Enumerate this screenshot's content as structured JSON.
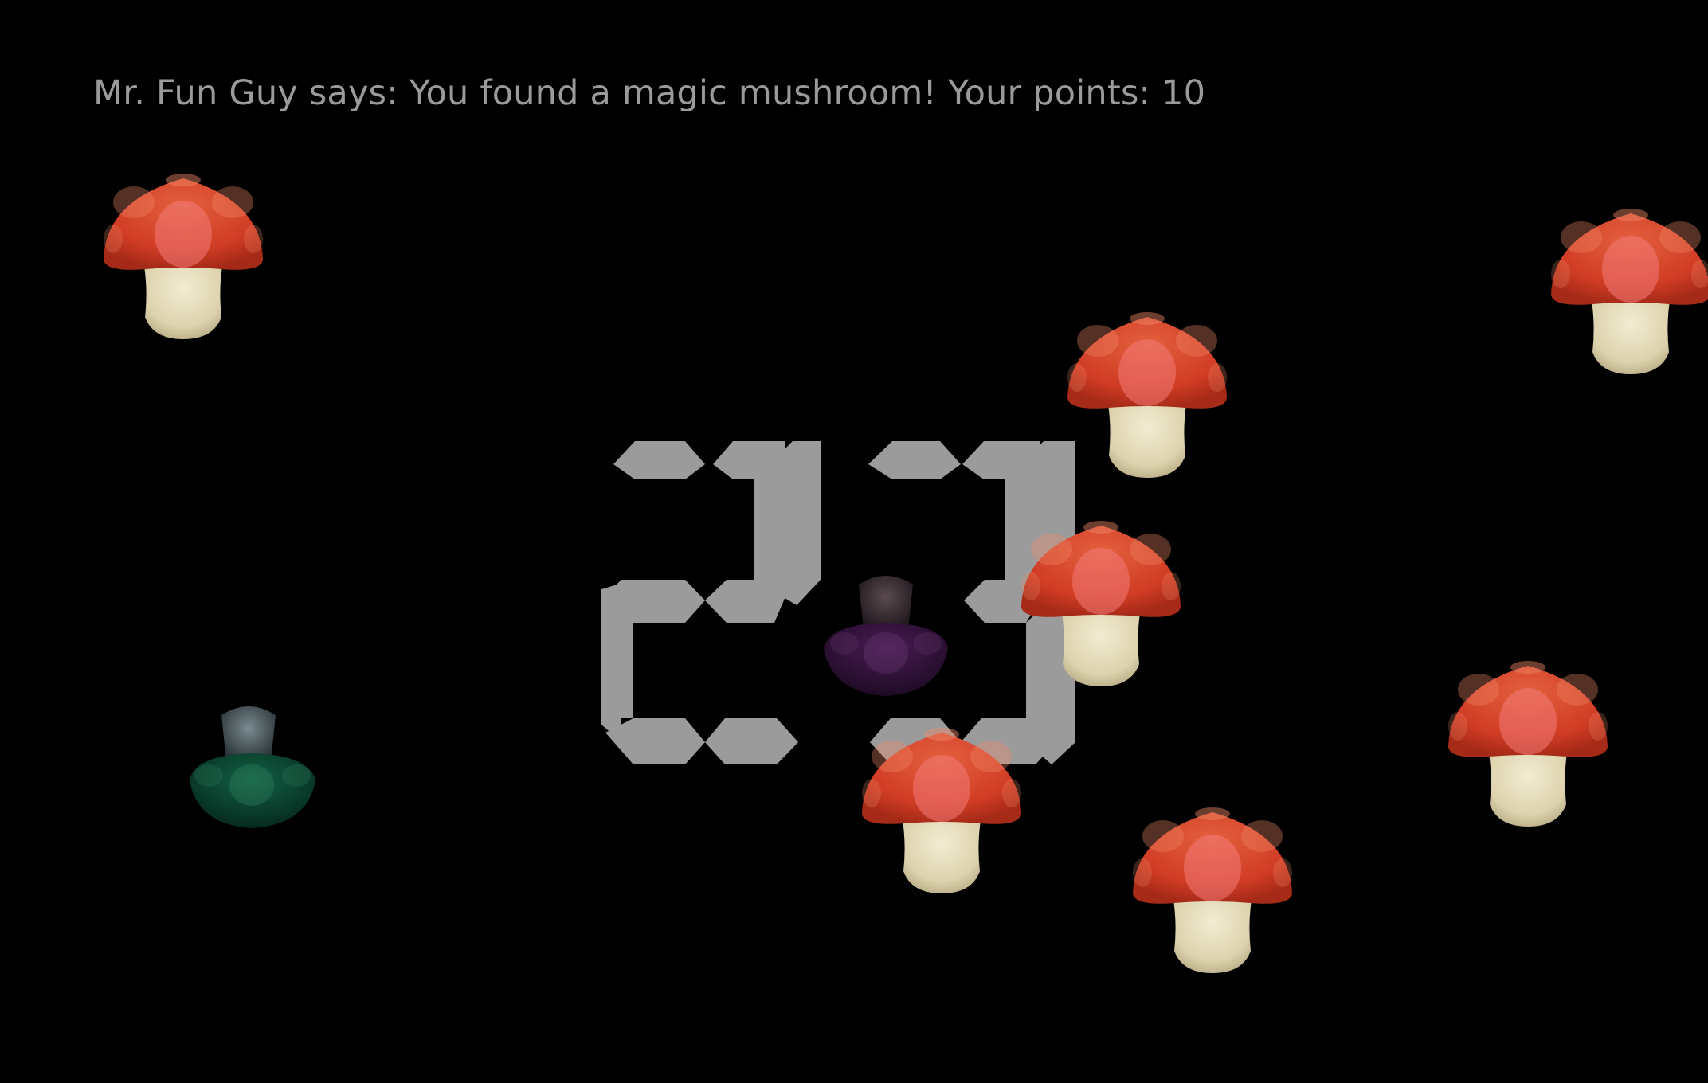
{
  "message": "Mr. Fun Guy says: You found a magic mushroom! Your points: 10",
  "timer": {
    "display": "23",
    "color": "#9b9b9b"
  },
  "colors": {
    "background": "#000000",
    "text": "#9a9a9a",
    "red_cap": "#d6452a",
    "stem": "#e9e2c2",
    "purple_cap": "#3a1642",
    "green_cap": "#0e4a33"
  },
  "mushrooms": [
    {
      "kind": "red",
      "icon": "red-mushroom-icon"
    },
    {
      "kind": "red",
      "icon": "red-mushroom-icon"
    },
    {
      "kind": "red",
      "icon": "red-mushroom-icon"
    },
    {
      "kind": "red",
      "icon": "red-mushroom-icon"
    },
    {
      "kind": "red",
      "icon": "red-mushroom-icon"
    },
    {
      "kind": "red",
      "icon": "red-mushroom-icon"
    },
    {
      "kind": "red",
      "icon": "red-mushroom-icon"
    },
    {
      "kind": "purple-inverted",
      "icon": "purple-mushroom-icon"
    },
    {
      "kind": "green-inverted",
      "icon": "green-mushroom-icon"
    }
  ]
}
